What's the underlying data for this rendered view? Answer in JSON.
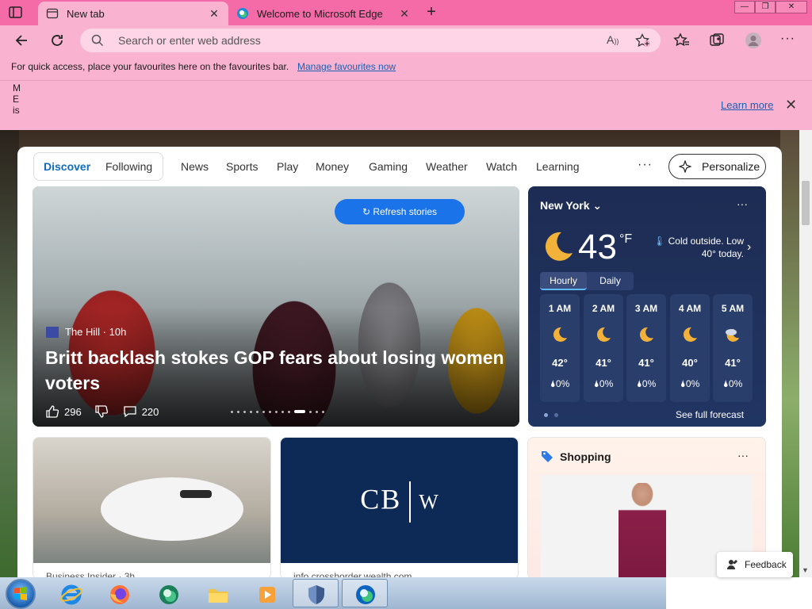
{
  "tabs": [
    {
      "label": "New tab",
      "active": true
    },
    {
      "label": "Welcome to Microsoft Edge",
      "active": false
    }
  ],
  "window_controls": {
    "minimize": "—",
    "restore": "❐",
    "close": "✕"
  },
  "toolbar": {
    "address_placeholder": "Search or enter web address"
  },
  "favourites_bar": {
    "message": "For quick access, place your favourites here on the favourites bar.",
    "link": "Manage favourites now"
  },
  "info_banner": {
    "vertical_text": "M E is",
    "learn_more": "Learn more"
  },
  "nav": {
    "items": [
      "Discover",
      "Following",
      "News",
      "Sports",
      "Play",
      "Money",
      "Gaming",
      "Weather",
      "Watch",
      "Learning"
    ],
    "active": "Discover",
    "more": "···",
    "personalize": "Personalize"
  },
  "hero": {
    "refresh": "Refresh stories",
    "source": "The Hill · 10h",
    "headline": "Britt backlash stokes GOP fears about losing women voters",
    "likes": "296",
    "comments": "220"
  },
  "weather": {
    "city": "New York",
    "temp": "43",
    "unit": "°F",
    "description": "Cold outside. Low 40° today.",
    "tab_hourly": "Hourly",
    "tab_daily": "Daily",
    "hours": [
      {
        "time": "1 AM",
        "temp": "42°",
        "precip": "0%",
        "icon": "moon-icon"
      },
      {
        "time": "2 AM",
        "temp": "41°",
        "precip": "0%",
        "icon": "moon-icon"
      },
      {
        "time": "3 AM",
        "temp": "41°",
        "precip": "0%",
        "icon": "moon-icon"
      },
      {
        "time": "4 AM",
        "temp": "40°",
        "precip": "0%",
        "icon": "moon-icon"
      },
      {
        "time": "5 AM",
        "temp": "41°",
        "precip": "0%",
        "icon": "partly-cloudy-night-icon"
      }
    ],
    "forecast_link": "See full forecast"
  },
  "cards": {
    "airplane_source": "Business Insider · 3h",
    "cbw_logo_left": "CB",
    "cbw_logo_right": "W",
    "cbw_source": "info.crosshorder.wealth.com",
    "shopping_title": "Shopping"
  },
  "feedback": "Feedback",
  "colors": {
    "title_bar": "#f56ba7",
    "toolbar": "#f9b3d1",
    "accent": "#0f6cbd",
    "refresh_button": "#1a73e8",
    "weather_card": "#1d2c53"
  }
}
